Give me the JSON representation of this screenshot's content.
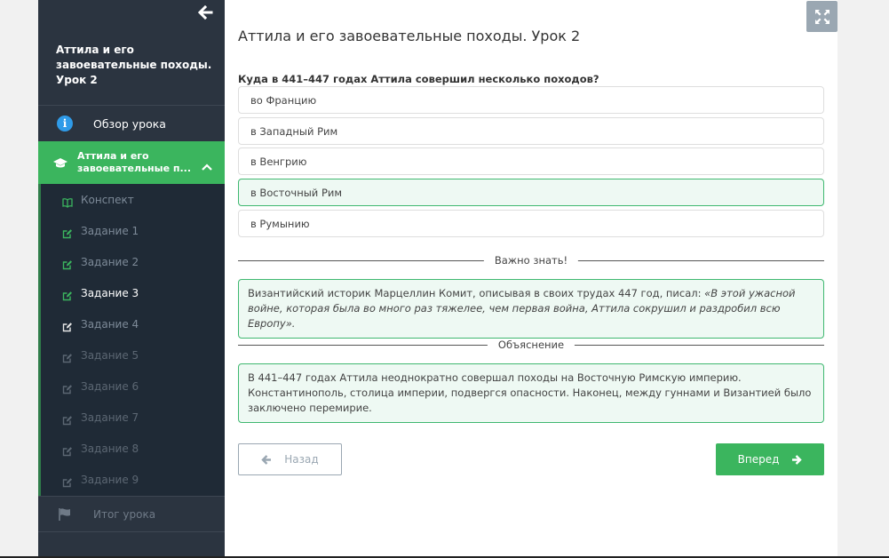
{
  "sidebar": {
    "course_title": "Аттила и его завоевательные походы. Урок 2",
    "overview_label": "Обзор урока",
    "active_lesson_label": "Аттила и его завоевательные п...",
    "items": [
      {
        "label": "Конспект",
        "icon": "book-icon",
        "state": "done"
      },
      {
        "label": "Задание 1",
        "icon": "edit-icon",
        "state": "done"
      },
      {
        "label": "Задание 2",
        "icon": "edit-icon",
        "state": "done"
      },
      {
        "label": "Задание 3",
        "icon": "edit-icon",
        "state": "current"
      },
      {
        "label": "Задание 4",
        "icon": "edit-icon",
        "state": "pending"
      },
      {
        "label": "Задание 5",
        "icon": "edit-icon",
        "state": "locked"
      },
      {
        "label": "Задание 6",
        "icon": "edit-icon",
        "state": "locked"
      },
      {
        "label": "Задание 7",
        "icon": "edit-icon",
        "state": "locked"
      },
      {
        "label": "Задание 8",
        "icon": "edit-icon",
        "state": "locked"
      },
      {
        "label": "Задание 9",
        "icon": "edit-icon",
        "state": "locked"
      }
    ],
    "final_label": "Итог урока"
  },
  "main": {
    "title": "Аттила и его завоевательные походы. Урок 2",
    "question": "Куда в 441–447 годах Аттила совершил несколько походов?",
    "options": [
      {
        "label": "во Францию"
      },
      {
        "label": "в Западный Рим"
      },
      {
        "label": "в Венгрию"
      },
      {
        "label": "в Восточный Рим"
      },
      {
        "label": "в Румынию"
      }
    ],
    "important_header": "Важно знать!",
    "important_text_plain": "Византийский историк Марцеллин Комит, описывая в своих трудах 447 год, писал: ",
    "important_text_quote": "«В этой ужасной войне, которая была во много раз тяжелее, чем первая война, Аттила сокрушил и раздробил всю Европу».",
    "explanation_header": "Объяснение",
    "explanation_text": "В 441–447 годах Аттила неоднократно совершал походы на Восточную Римскую империю. Константинополь, столица империи, подвергся опасности. Наконец, между гуннами и Византией было заключено перемирие.",
    "back_label": "Назад",
    "next_label": "Вперед"
  },
  "colors": {
    "sidebar_bg": "#2b3440",
    "accent_green": "#3bb55e",
    "info_blue": "#2f9be8",
    "correct_bg": "#eef9f3"
  }
}
